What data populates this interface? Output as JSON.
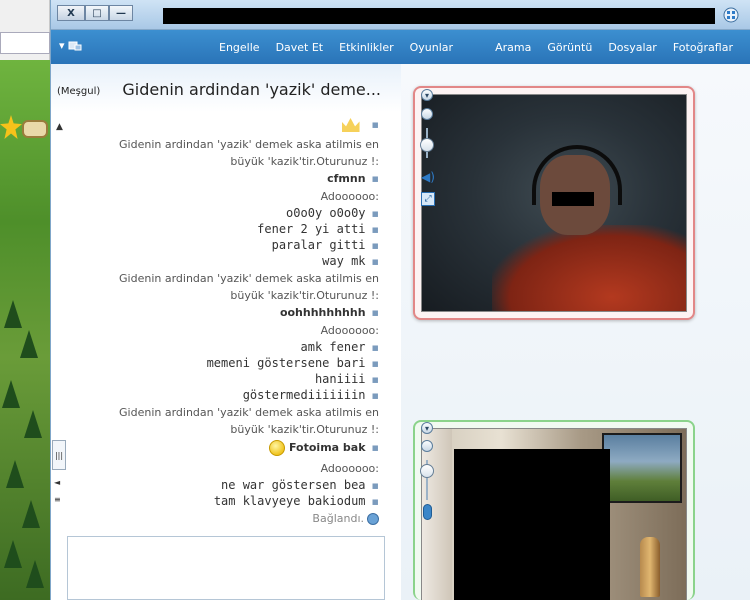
{
  "window": {
    "close_glyph": "X",
    "maximize_glyph": "□",
    "minimize_glyph": "—"
  },
  "menu": {
    "items": [
      "Fotoğraflar",
      "Dosyalar",
      "Görüntü",
      "Arama",
      "Oyunlar",
      "Etkinlikler",
      "Davet Et",
      "Engelle"
    ]
  },
  "chat": {
    "title": "Gidenin ardindan 'yazik' deme...",
    "status": "(Meşgul)",
    "lines": [
      {
        "kind": "sys",
        "text": "Gidenin ardindan 'yazik' demek aska atilmis en"
      },
      {
        "kind": "sys",
        "text": "büyük 'kazik'tir.Oturunuz !:"
      },
      {
        "kind": "name",
        "text": "cfmnn"
      },
      {
        "kind": "sys",
        "text": "Adoooooo:"
      },
      {
        "kind": "msg",
        "text": "o0o0y o0o0y"
      },
      {
        "kind": "msg",
        "text": "fener 2 yi atti"
      },
      {
        "kind": "msg",
        "text": "paralar gitti"
      },
      {
        "kind": "msg",
        "text": "way mk"
      },
      {
        "kind": "sys",
        "text": "Gidenin ardindan 'yazik' demek aska atilmis en"
      },
      {
        "kind": "sys",
        "text": "büyük 'kazik'tir.Oturunuz !:"
      },
      {
        "kind": "name",
        "text": "oohhhhhhhhh"
      },
      {
        "kind": "sys",
        "text": "Adoooooo:"
      },
      {
        "kind": "msg",
        "text": "amk fener"
      },
      {
        "kind": "msg",
        "text": "memeni göstersene bari"
      },
      {
        "kind": "msg",
        "text": "haniiii"
      },
      {
        "kind": "msg",
        "text": "göstermediiiiiiin"
      },
      {
        "kind": "sys",
        "text": "Gidenin ardindan 'yazik' demek aska atilmis en"
      },
      {
        "kind": "sys",
        "text": "büyük 'kazik'tir.Oturunuz !:"
      },
      {
        "kind": "name",
        "text": "Fotoima bak"
      },
      {
        "kind": "sys",
        "text": "Adoooooo:"
      },
      {
        "kind": "msg",
        "text": "ne war göstersen bea"
      },
      {
        "kind": "msg",
        "text": "tam klavyeye bakiodum"
      },
      {
        "kind": "sys",
        "text": "Bağlandı."
      }
    ]
  },
  "icons": {
    "crown": "crown-icon",
    "smiley": "smiley-icon",
    "connected": "connected-icon"
  },
  "colors": {
    "menubar": "#2a74b8",
    "cam1_border": "#e28787",
    "cam2_border": "#8bd38b"
  }
}
